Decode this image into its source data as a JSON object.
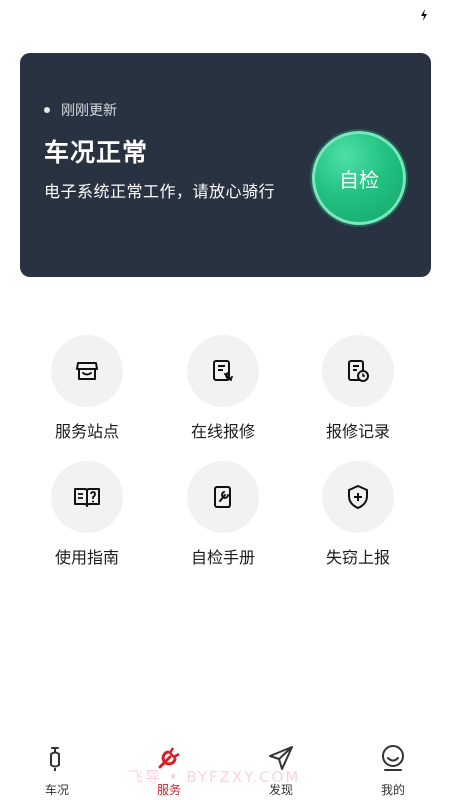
{
  "status": {
    "update_text": "刚刚更新",
    "title": "车况正常",
    "description": "电子系统正常工作，请放心骑行",
    "selfcheck_label": "自检"
  },
  "services": [
    {
      "label": "服务站点",
      "icon": "store-icon"
    },
    {
      "label": "在线报修",
      "icon": "repair-doc-icon"
    },
    {
      "label": "报修记录",
      "icon": "record-clock-icon"
    },
    {
      "label": "使用指南",
      "icon": "book-guide-icon"
    },
    {
      "label": "自检手册",
      "icon": "manual-wrench-icon"
    },
    {
      "label": "失窃上报",
      "icon": "shield-plus-icon"
    }
  ],
  "tabs": [
    {
      "label": "车况",
      "icon": "scooter-icon"
    },
    {
      "label": "服务",
      "icon": "wrench-icon",
      "active": true
    },
    {
      "label": "发现",
      "icon": "send-icon"
    },
    {
      "label": "我的",
      "icon": "profile-icon"
    }
  ],
  "watermark": "飞导 • BYFZXY.COM",
  "colors": {
    "card_bg": "#283241",
    "selfcheck_green": "#22c283",
    "active_tab": "#d42027",
    "icon_circle": "#f2f2f2"
  }
}
